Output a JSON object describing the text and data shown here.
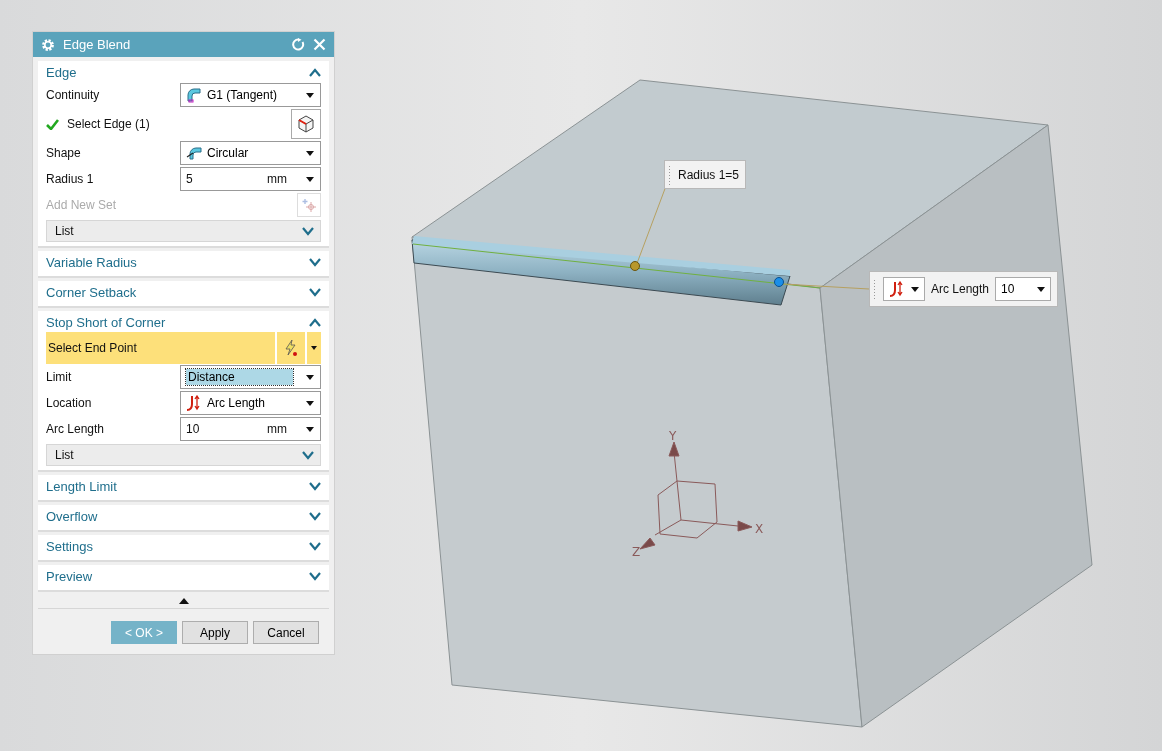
{
  "dialog": {
    "title": "Edge Blend",
    "sections": [
      {
        "title": "Edge",
        "expanded": true,
        "rows": [
          {
            "kind": "dropdown",
            "label": "Continuity",
            "value": "G1 (Tangent)",
            "focused": false
          },
          {
            "kind": "selection",
            "label": "Select Edge (1)",
            "complete": true,
            "active": false
          },
          {
            "kind": "dropdown",
            "label": "Shape",
            "value": "Circular",
            "focused": false
          },
          {
            "kind": "unit_input",
            "label": "Radius 1",
            "value": "5",
            "unit": "mm"
          },
          {
            "kind": "action",
            "label": "Add New Set",
            "disabled": true
          },
          {
            "kind": "list",
            "label": "List"
          }
        ]
      },
      {
        "title": "Variable Radius",
        "expanded": false
      },
      {
        "title": "Corner Setback",
        "expanded": false
      },
      {
        "title": "Stop Short of Corner",
        "expanded": true,
        "rows": [
          {
            "kind": "selection",
            "label": "Select End Point",
            "complete": false,
            "active": true
          },
          {
            "kind": "dropdown",
            "label": "Limit",
            "value": "Distance",
            "focused": true
          },
          {
            "kind": "dropdown",
            "label": "Location",
            "value": "Arc Length",
            "focused": false
          },
          {
            "kind": "unit_input",
            "label": "Arc Length",
            "value": "10",
            "unit": "mm"
          },
          {
            "kind": "list",
            "label": "List"
          }
        ]
      },
      {
        "title": "Length Limit",
        "expanded": false
      },
      {
        "title": "Overflow",
        "expanded": false
      },
      {
        "title": "Settings",
        "expanded": false
      },
      {
        "title": "Preview",
        "expanded": false
      }
    ],
    "buttons": [
      {
        "label": "< OK >",
        "default": true
      },
      {
        "label": "Apply",
        "default": false
      },
      {
        "label": "Cancel",
        "default": false
      }
    ]
  },
  "viewport": {
    "radius_label": "Radius 1=5",
    "arc_label": "Arc Length",
    "arc_value": "10",
    "axes": {
      "x": "X",
      "y": "Y",
      "z": "Z"
    }
  }
}
